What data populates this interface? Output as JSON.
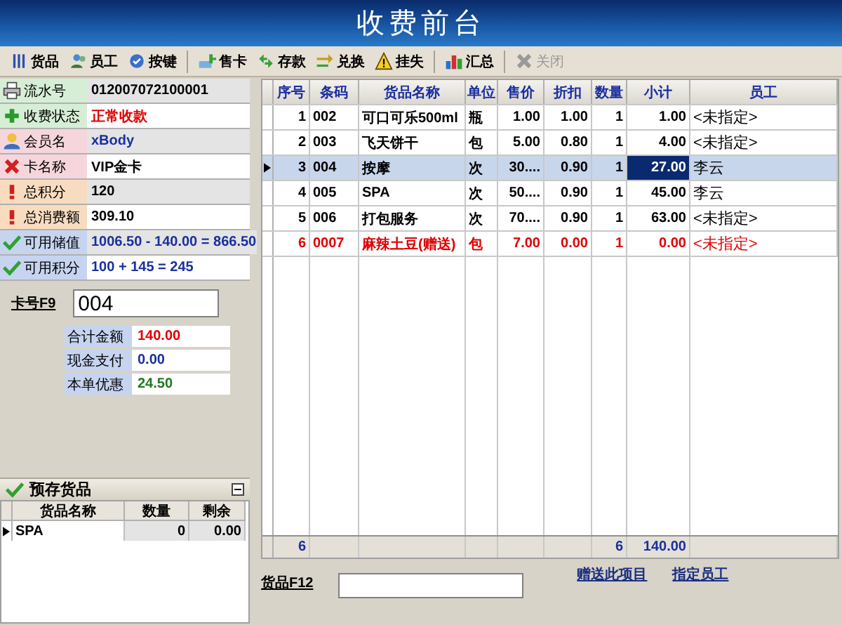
{
  "window": {
    "title": "收费前台"
  },
  "toolbar": [
    {
      "kind": "button",
      "label": "货品",
      "disabled": false
    },
    {
      "kind": "button",
      "label": "员工",
      "disabled": false
    },
    {
      "kind": "button",
      "label": "按键",
      "disabled": false
    },
    {
      "kind": "separator"
    },
    {
      "kind": "button",
      "label": "售卡",
      "disabled": false
    },
    {
      "kind": "button",
      "label": "存款",
      "disabled": false
    },
    {
      "kind": "button",
      "label": "兑换",
      "disabled": false
    },
    {
      "kind": "button",
      "label": "挂失",
      "disabled": false
    },
    {
      "kind": "separator"
    },
    {
      "kind": "button",
      "label": "汇总",
      "disabled": false
    },
    {
      "kind": "separator"
    },
    {
      "kind": "button",
      "label": "关闭",
      "disabled": true
    }
  ],
  "info": [
    {
      "label": "流水号",
      "value": "012007072100001",
      "color": "#000000"
    },
    {
      "label": "收费状态",
      "value": "正常收款",
      "color": "#e00000"
    },
    {
      "label": "会员名",
      "value": "xBody",
      "color": "#1a2fa0"
    },
    {
      "label": "卡名称",
      "value": "VIP金卡",
      "color": "#000000"
    },
    {
      "label": "总积分",
      "value": "120",
      "color": "#000000"
    },
    {
      "label": "总消费额",
      "value": "309.10",
      "color": "#000000"
    },
    {
      "label": "可用储值",
      "value": "1006.50 - 140.00 = 866.50",
      "color": "#1a2fa0"
    },
    {
      "label": "可用积分",
      "value": "100 + 145 = 245",
      "color": "#1a2fa0"
    }
  ],
  "card_number": {
    "label": "卡号F9",
    "value": "004"
  },
  "totals": [
    {
      "label": "合计金额",
      "value": "140.00",
      "color": "#e00000"
    },
    {
      "label": "现金支付",
      "value": "0.00",
      "color": "#1a2fa0"
    },
    {
      "label": "本单优惠",
      "value": "24.50",
      "color": "#1e7a1e"
    }
  ],
  "prepaid": {
    "title": "预存货品",
    "expanded": true,
    "columns": [
      "货品名称",
      "数量",
      "剩余"
    ],
    "rows": [
      {
        "selected": true,
        "cells": [
          "SPA",
          "0",
          "0.00"
        ]
      }
    ]
  },
  "table": {
    "columns": [
      "序号",
      "条码",
      "货品名称",
      "单位",
      "售价",
      "折扣",
      "数量",
      "小计",
      "员工"
    ],
    "rows": [
      {
        "selected": false,
        "gift": false,
        "cells": [
          "1",
          "002",
          "可口可乐500ml",
          "瓶",
          "1.00",
          "1.00",
          "1",
          "1.00",
          "<未指定>"
        ]
      },
      {
        "selected": false,
        "gift": false,
        "cells": [
          "2",
          "003",
          "飞天饼干",
          "包",
          "5.00",
          "0.80",
          "1",
          "4.00",
          "<未指定>"
        ]
      },
      {
        "selected": true,
        "gift": false,
        "cells": [
          "3",
          "004",
          "按摩",
          "次",
          "30....",
          "0.90",
          "1",
          "27.00",
          "李云"
        ]
      },
      {
        "selected": false,
        "gift": false,
        "cells": [
          "4",
          "005",
          "SPA",
          "次",
          "50....",
          "0.90",
          "1",
          "45.00",
          "李云"
        ]
      },
      {
        "selected": false,
        "gift": false,
        "cells": [
          "5",
          "006",
          "打包服务",
          "次",
          "70....",
          "0.90",
          "1",
          "63.00",
          "<未指定>"
        ]
      },
      {
        "selected": false,
        "gift": true,
        "cells": [
          "6",
          "0007",
          "麻辣土豆(赠送)",
          "包",
          "7.00",
          "0.00",
          "1",
          "0.00",
          "<未指定>"
        ]
      }
    ],
    "footer": {
      "count": "6",
      "quantity": "6",
      "total": "140.00"
    }
  },
  "bottom": {
    "item_label": "货品F12",
    "links": [
      "赠送此项目",
      "指定员工"
    ]
  }
}
